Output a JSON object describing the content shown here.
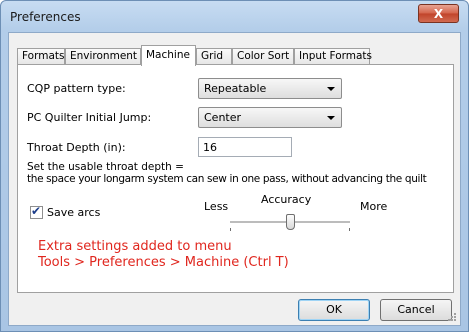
{
  "window": {
    "title": "Preferences",
    "close_label": "X"
  },
  "tabs": [
    {
      "label": "Formats"
    },
    {
      "label": "Environment"
    },
    {
      "label": "Machine"
    },
    {
      "label": "Grid"
    },
    {
      "label": "Color Sort"
    },
    {
      "label": "Input Formats"
    }
  ],
  "machine": {
    "pattern_type_label": "CQP pattern type:",
    "pattern_type_value": "Repeatable",
    "initial_jump_label": "PC Quilter Initial Jump:",
    "initial_jump_value": "Center",
    "throat_depth_label": "Throat Depth (in):",
    "throat_depth_value": "16",
    "throat_help_line1": "Set the usable throat depth =",
    "throat_help_line2": "the space your longarm system can sew in one pass, without advancing the quilt",
    "save_arcs_label": "Save arcs",
    "save_arcs_checked": true,
    "accuracy_label": "Accuracy",
    "accuracy_less": "Less",
    "accuracy_more": "More",
    "accuracy_level": 0.5
  },
  "annotation": {
    "line1": "Extra settings added to menu",
    "line2": "Tools > Preferences > Machine (Ctrl T)"
  },
  "buttons": {
    "ok": "OK",
    "cancel": "Cancel"
  },
  "colors": {
    "annotation": "#e0261e",
    "close_button": "#c0432a"
  }
}
